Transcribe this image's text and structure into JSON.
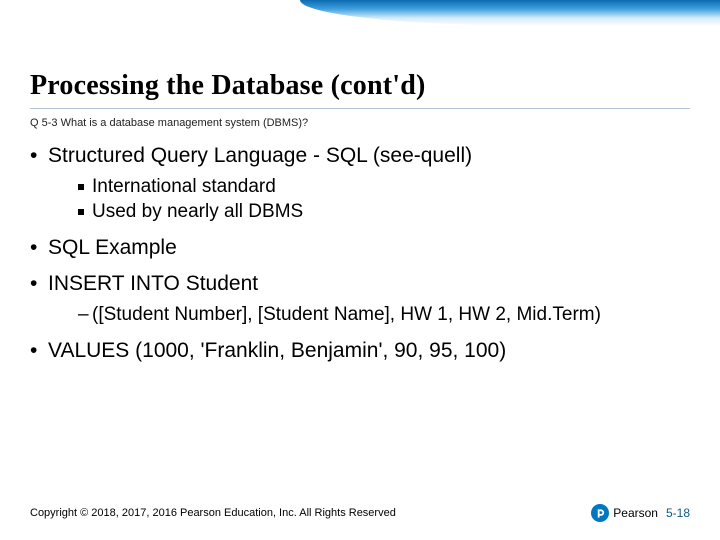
{
  "title": "Processing the Database (cont'd)",
  "subtitle": "Q 5-3 What is a database management system (DBMS)?",
  "bullets": {
    "b1": "Structured Query Language - SQL (see-quell)",
    "b1_sub1": "International standard",
    "b1_sub2": "Used by nearly all DBMS",
    "b2": "SQL Example",
    "b3": "INSERT INTO Student",
    "b3_sub1": "([Student Number], [Student Name], HW 1, HW 2, Mid.Term)",
    "b4": "VALUES (1000, 'Franklin, Benjamin', 90, 95, 100)"
  },
  "footer": {
    "copyright": "Copyright © 2018, 2017, 2016 Pearson Education, Inc. All Rights Reserved",
    "brand": "Pearson",
    "page": "5-18"
  }
}
